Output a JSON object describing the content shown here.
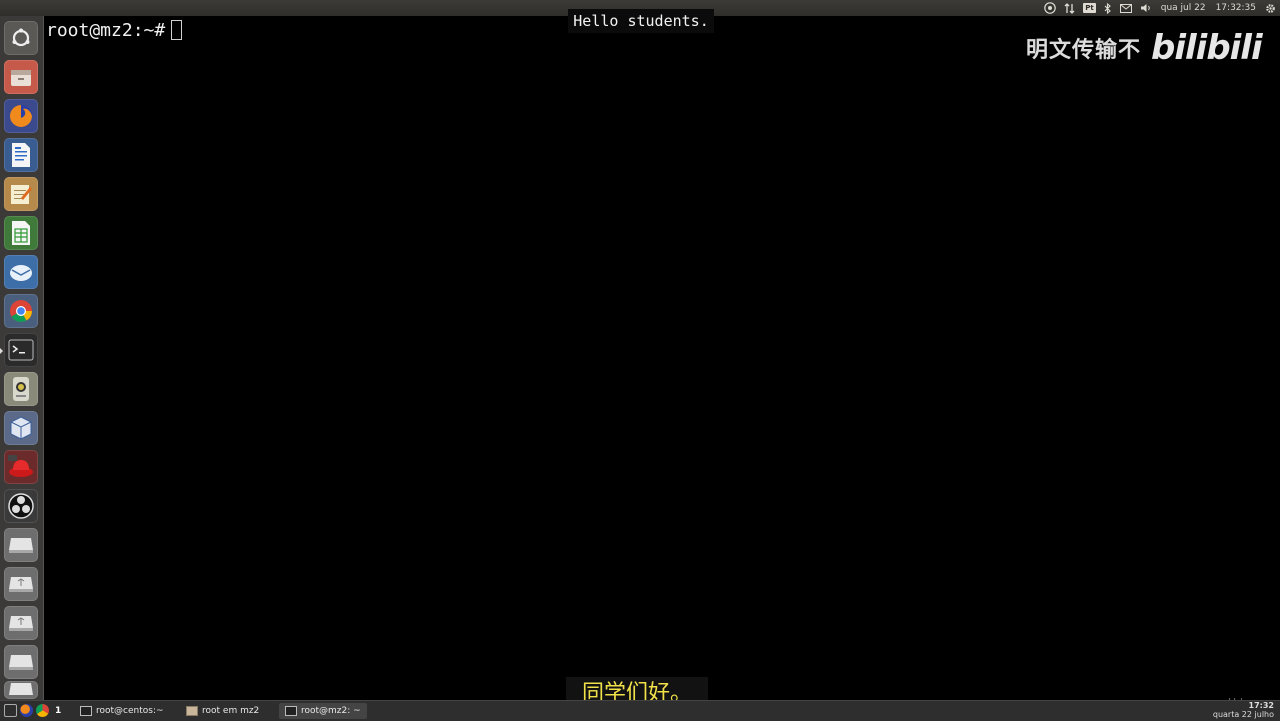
{
  "top_panel": {
    "keyboard_layout": "Pt",
    "date": "qua jul 22",
    "time": "17:32:35"
  },
  "launcher": {
    "items": [
      {
        "icon": "ubuntu-dash-icon"
      },
      {
        "icon": "files-icon"
      },
      {
        "icon": "firefox-icon"
      },
      {
        "icon": "writer-icon"
      },
      {
        "icon": "text-editor-icon"
      },
      {
        "icon": "calc-icon"
      },
      {
        "icon": "mail-icon"
      },
      {
        "icon": "chrome-icon"
      },
      {
        "icon": "terminal-icon"
      },
      {
        "icon": "system-tool-icon"
      },
      {
        "icon": "virtualbox-icon"
      },
      {
        "icon": "redhat-icon"
      },
      {
        "icon": "obs-icon"
      },
      {
        "icon": "drive-icon"
      },
      {
        "icon": "usb-drive-icon"
      },
      {
        "icon": "usb-drive-icon"
      },
      {
        "icon": "drive-icon"
      },
      {
        "icon": "drive-icon"
      }
    ]
  },
  "terminal": {
    "prompt": "root@mz2:~#"
  },
  "overlay": {
    "hello_subtitle": "Hello students.",
    "watermark_text": "明文传输不",
    "watermark_logo": "bilibili",
    "cn_subtitle": "同学们好。",
    "udemy": "Udemy"
  },
  "taskbar": {
    "workspace_number": "1",
    "tasks": [
      {
        "label": "root@centos:~"
      },
      {
        "label": "root em mz2"
      },
      {
        "label": "root@mz2: ~"
      }
    ],
    "clock_time": "17:32",
    "clock_date": "quarta 22 julho"
  }
}
